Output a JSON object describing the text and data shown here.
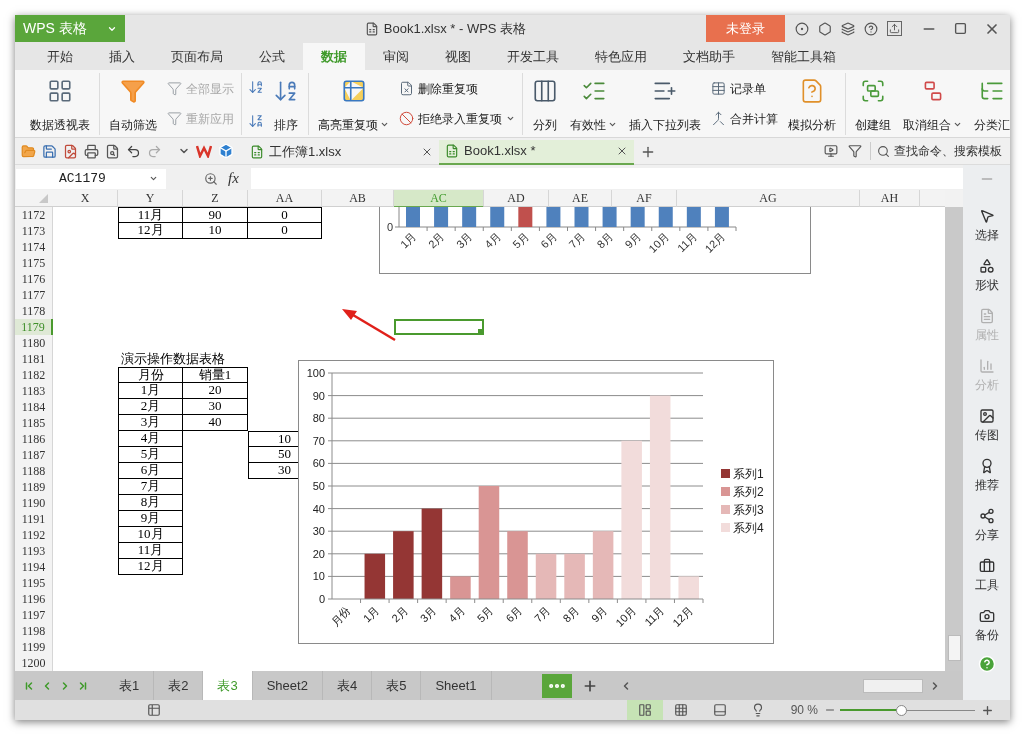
{
  "app_button": {
    "label": "WPS 表格"
  },
  "window": {
    "title": "Book1.xlsx * - WPS 表格"
  },
  "login_button": {
    "label": "未登录"
  },
  "menu_tabs": [
    {
      "label": "开始",
      "selected": false
    },
    {
      "label": "插入",
      "selected": false
    },
    {
      "label": "页面布局",
      "selected": false
    },
    {
      "label": "公式",
      "selected": false
    },
    {
      "label": "数据",
      "selected": true
    },
    {
      "label": "审阅",
      "selected": false
    },
    {
      "label": "视图",
      "selected": false
    },
    {
      "label": "开发工具",
      "selected": false
    },
    {
      "label": "特色应用",
      "selected": false
    },
    {
      "label": "文档助手",
      "selected": false
    },
    {
      "label": "智能工具箱",
      "selected": false
    }
  ],
  "ribbon_groups": [
    {
      "items": [
        {
          "kind": "large",
          "label": "数据透视表",
          "disabled": false,
          "dropdown": false
        }
      ]
    },
    {
      "items": [
        {
          "kind": "large",
          "label": "自动筛选",
          "disabled": false,
          "dropdown": false
        },
        {
          "kind": "stack",
          "items": [
            {
              "label": "全部显示",
              "disabled": true,
              "dropdown": false
            },
            {
              "label": "重新应用",
              "disabled": true,
              "dropdown": false
            }
          ]
        }
      ]
    },
    {
      "items": [
        {
          "kind": "sort_icons"
        },
        {
          "kind": "large",
          "label": "排序",
          "disabled": false,
          "dropdown": false
        }
      ]
    },
    {
      "items": [
        {
          "kind": "large",
          "label": "高亮重复项",
          "disabled": false,
          "dropdown": true
        },
        {
          "kind": "stack",
          "items": [
            {
              "label": "删除重复项",
              "disabled": false,
              "dropdown": false
            },
            {
              "label": "拒绝录入重复项",
              "disabled": false,
              "dropdown": true
            }
          ]
        }
      ]
    },
    {
      "items": [
        {
          "kind": "large",
          "label": "分列",
          "disabled": false,
          "dropdown": false
        },
        {
          "kind": "large",
          "label": "有效性",
          "disabled": false,
          "dropdown": true
        },
        {
          "kind": "large",
          "label": "插入下拉列表",
          "disabled": false,
          "dropdown": false
        },
        {
          "kind": "stack",
          "items": [
            {
              "label": "记录单",
              "disabled": false,
              "dropdown": false
            },
            {
              "label": "合并计算",
              "disabled": false,
              "dropdown": false
            }
          ]
        },
        {
          "kind": "large",
          "label": "模拟分析",
          "disabled": false,
          "dropdown": false
        }
      ]
    },
    {
      "items": [
        {
          "kind": "large",
          "label": "创建组",
          "disabled": false,
          "dropdown": false
        },
        {
          "kind": "large",
          "label": "取消组合",
          "disabled": false,
          "dropdown": true
        },
        {
          "kind": "large",
          "label": "分类汇",
          "disabled": false,
          "dropdown": false
        }
      ]
    }
  ],
  "document_tabs": [
    {
      "label": "工作簿1.xlsx",
      "selected": false
    },
    {
      "label": "Book1.xlsx *",
      "selected": true
    }
  ],
  "search_command": {
    "label": "查找命令、搜索模板"
  },
  "formula_bar": {
    "name_box": "AC1179",
    "fx_label": "fx"
  },
  "columns": [
    {
      "label": "X",
      "selected": false
    },
    {
      "label": "Y",
      "selected": false
    },
    {
      "label": "Z",
      "selected": false
    },
    {
      "label": "AA",
      "selected": false
    },
    {
      "label": "AB",
      "selected": false
    },
    {
      "label": "AC",
      "selected": true
    },
    {
      "label": "AD",
      "selected": false
    },
    {
      "label": "AE",
      "selected": false
    },
    {
      "label": "AF",
      "selected": false
    },
    {
      "label": "AG",
      "selected": false
    },
    {
      "label": "AH",
      "selected": false
    }
  ],
  "rows": [
    {
      "number": "1172",
      "selected": false
    },
    {
      "number": "1173",
      "selected": false
    },
    {
      "number": "1174",
      "selected": false
    },
    {
      "number": "1175",
      "selected": false
    },
    {
      "number": "1176",
      "selected": false
    },
    {
      "number": "1177",
      "selected": false
    },
    {
      "number": "1178",
      "selected": false
    },
    {
      "number": "1179",
      "selected": true
    },
    {
      "number": "1180",
      "selected": false
    },
    {
      "number": "1181",
      "selected": false
    },
    {
      "number": "1182",
      "selected": false
    },
    {
      "number": "1183",
      "selected": false
    },
    {
      "number": "1184",
      "selected": false
    },
    {
      "number": "1185",
      "selected": false
    },
    {
      "number": "1186",
      "selected": false
    },
    {
      "number": "1187",
      "selected": false
    },
    {
      "number": "1188",
      "selected": false
    },
    {
      "number": "1189",
      "selected": false
    },
    {
      "number": "1190",
      "selected": false
    },
    {
      "number": "1191",
      "selected": false
    },
    {
      "number": "1192",
      "selected": false
    },
    {
      "number": "1193",
      "selected": false
    },
    {
      "number": "1194",
      "selected": false
    },
    {
      "number": "1195",
      "selected": false
    },
    {
      "number": "1196",
      "selected": false
    },
    {
      "number": "1197",
      "selected": false
    },
    {
      "number": "1198",
      "selected": false
    },
    {
      "number": "1199",
      "selected": false
    },
    {
      "number": "1200",
      "selected": false
    }
  ],
  "top_table": {
    "rows": [
      [
        "11月",
        "90",
        "0"
      ],
      [
        "12月",
        "10",
        "0"
      ]
    ]
  },
  "demo_table": {
    "title": "演示操作数据表格",
    "header": [
      "月份",
      "销量1"
    ],
    "rows": [
      {
        "month": "1月",
        "sales": "20"
      },
      {
        "month": "2月",
        "sales": "30"
      },
      {
        "month": "3月",
        "sales": "40"
      },
      {
        "month": "4月",
        "column_3": "10"
      },
      {
        "month": "5月",
        "column_3": "50"
      },
      {
        "month": "6月",
        "column_3": "30"
      },
      {
        "month": "7月"
      },
      {
        "month": "8月"
      },
      {
        "month": "9月"
      },
      {
        "month": "10月"
      },
      {
        "month": "11月"
      },
      {
        "month": "12月"
      }
    ]
  },
  "top_chart": {
    "tick": "0",
    "bars": [
      {
        "label": "1月",
        "highlighted": false
      },
      {
        "label": "2月",
        "highlighted": false
      },
      {
        "label": "3月",
        "highlighted": false
      },
      {
        "label": "4月",
        "highlighted": false
      },
      {
        "label": "5月",
        "highlighted": true
      },
      {
        "label": "6月",
        "highlighted": false
      },
      {
        "label": "7月",
        "highlighted": false
      },
      {
        "label": "8月",
        "highlighted": false
      },
      {
        "label": "9月",
        "highlighted": false
      },
      {
        "label": "10月",
        "highlighted": false
      },
      {
        "label": "11月",
        "highlighted": false
      },
      {
        "label": "12月",
        "highlighted": false
      }
    ]
  },
  "main_chart": {
    "chart_data": {
      "type": "bar",
      "stacked": true,
      "categories": [
        "月份",
        "1月",
        "2月",
        "3月",
        "4月",
        "5月",
        "6月",
        "7月",
        "8月",
        "9月",
        "10月",
        "11月",
        "12月"
      ],
      "series": [
        {
          "name": "系列1",
          "color": "#943634",
          "values": [
            null,
            20,
            30,
            40,
            null,
            null,
            null,
            null,
            null,
            null,
            null,
            null,
            null
          ]
        },
        {
          "name": "系列2",
          "color": "#d99594",
          "values": [
            null,
            null,
            null,
            null,
            10,
            50,
            30,
            null,
            null,
            null,
            null,
            null,
            null
          ]
        },
        {
          "name": "系列3",
          "color": "#e5b8b7",
          "values": [
            null,
            null,
            null,
            null,
            null,
            null,
            null,
            20,
            20,
            30,
            null,
            null,
            null
          ]
        },
        {
          "name": "系列4",
          "color": "#f2dcdb",
          "values": [
            null,
            null,
            null,
            null,
            null,
            null,
            null,
            null,
            null,
            null,
            70,
            90,
            10
          ]
        }
      ],
      "grid": true,
      "legend": true,
      "ylim": [
        0,
        100
      ],
      "yticks": [
        {
          "value": 0,
          "label": "0"
        },
        {
          "value": 10,
          "label": "10"
        },
        {
          "value": 20,
          "label": "20"
        },
        {
          "value": 30,
          "label": "30"
        },
        {
          "value": 40,
          "label": "40"
        },
        {
          "value": 50,
          "label": "50"
        },
        {
          "value": 60,
          "label": "60"
        },
        {
          "value": 70,
          "label": "70"
        },
        {
          "value": 80,
          "label": "80"
        },
        {
          "value": 90,
          "label": "90"
        },
        {
          "value": 100,
          "label": "100"
        }
      ]
    }
  },
  "sidebar": [
    {
      "label": "选择",
      "disabled": false
    },
    {
      "label": "形状",
      "disabled": false
    },
    {
      "label": "属性",
      "disabled": true
    },
    {
      "label": "分析",
      "disabled": true
    },
    {
      "label": "传图",
      "disabled": false
    },
    {
      "label": "推荐",
      "disabled": false
    },
    {
      "label": "分享",
      "disabled": false
    },
    {
      "label": "工具",
      "disabled": false
    },
    {
      "label": "备份",
      "disabled": false
    }
  ],
  "sheet_tabs": [
    {
      "label": "表1",
      "selected": false
    },
    {
      "label": "表2",
      "selected": false
    },
    {
      "label": "表3",
      "selected": true
    },
    {
      "label": "Sheet2",
      "selected": false
    },
    {
      "label": "表4",
      "selected": false
    },
    {
      "label": "表5",
      "selected": false
    },
    {
      "label": "Sheet1",
      "selected": false
    }
  ],
  "status_bar": {
    "views": [
      {
        "selected": true
      },
      {
        "selected": false
      }
    ],
    "zoom": "90 %",
    "zoom_slider": {
      "level": 0.45
    }
  }
}
